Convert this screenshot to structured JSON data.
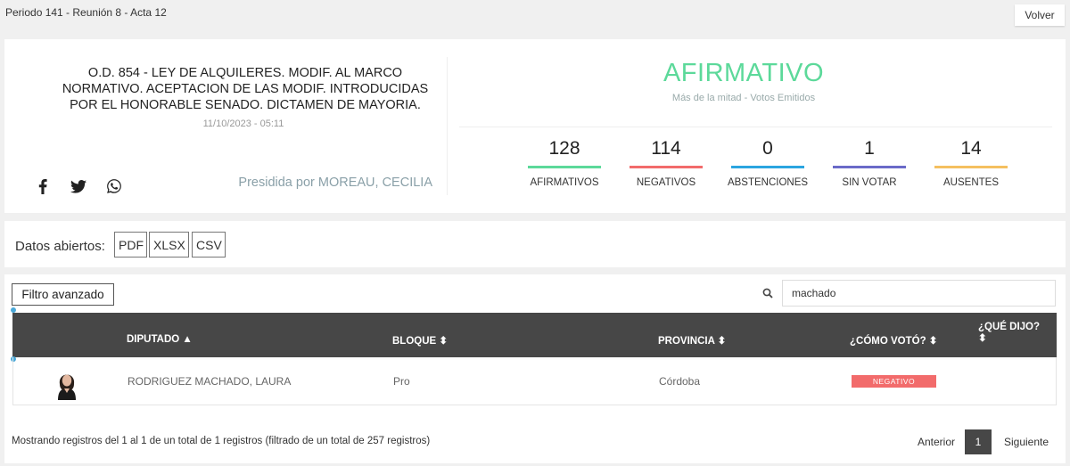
{
  "header": {
    "breadcrumb": "Periodo 141 - Reunión 8 - Acta 12",
    "back_label": "Volver"
  },
  "vote": {
    "title": "O.D. 854 - LEY DE ALQUILERES. MODIF. AL MARCO NORMATIVO. ACEPTACION DE LAS MODIF. INTRODUCIDAS POR EL HONORABLE SENADO. DICTAMEN DE MAYORIA.",
    "datetime": "11/10/2023 - 05:11",
    "presided_by": "Presidida por MOREAU, CECILIA",
    "result": "AFIRMATIVO",
    "result_color": "#5cd99a",
    "majority": "Más de la mitad - Votos Emitidos",
    "share_icons": [
      "facebook-icon",
      "twitter-icon",
      "whatsapp-icon"
    ],
    "stats": [
      {
        "value": "128",
        "label": "AFIRMATIVOS",
        "color": "#5cd99a"
      },
      {
        "value": "114",
        "label": "NEGATIVOS",
        "color": "#f26b6b"
      },
      {
        "value": "0",
        "label": "ABSTENCIONES",
        "color": "#2ba5e0"
      },
      {
        "value": "1",
        "label": "SIN VOTAR",
        "color": "#6a6ac8"
      },
      {
        "value": "14",
        "label": "AUSENTES",
        "color": "#f5c060"
      }
    ]
  },
  "open_data": {
    "label": "Datos abiertos:",
    "formats": [
      "PDF",
      "XLSX",
      "CSV"
    ]
  },
  "table": {
    "advanced_filter_label": "Filtro avanzado",
    "search_value": "machado",
    "columns": [
      "DIPUTADO",
      "BLOQUE",
      "PROVINCIA",
      "¿CÓMO VOTÓ?",
      "¿QUÉ DIJO?"
    ],
    "rows": [
      {
        "diputado": "RODRIGUEZ MACHADO, LAURA",
        "bloque": "Pro",
        "provincia": "Córdoba",
        "voto": "NEGATIVO",
        "voto_color": "#f26b6b"
      }
    ],
    "info": "Mostrando registros del 1 al 1 de un total de 1 registros (filtrado de un total de 257 registros)",
    "pagination": {
      "prev": "Anterior",
      "current": "1",
      "next": "Siguiente"
    }
  }
}
